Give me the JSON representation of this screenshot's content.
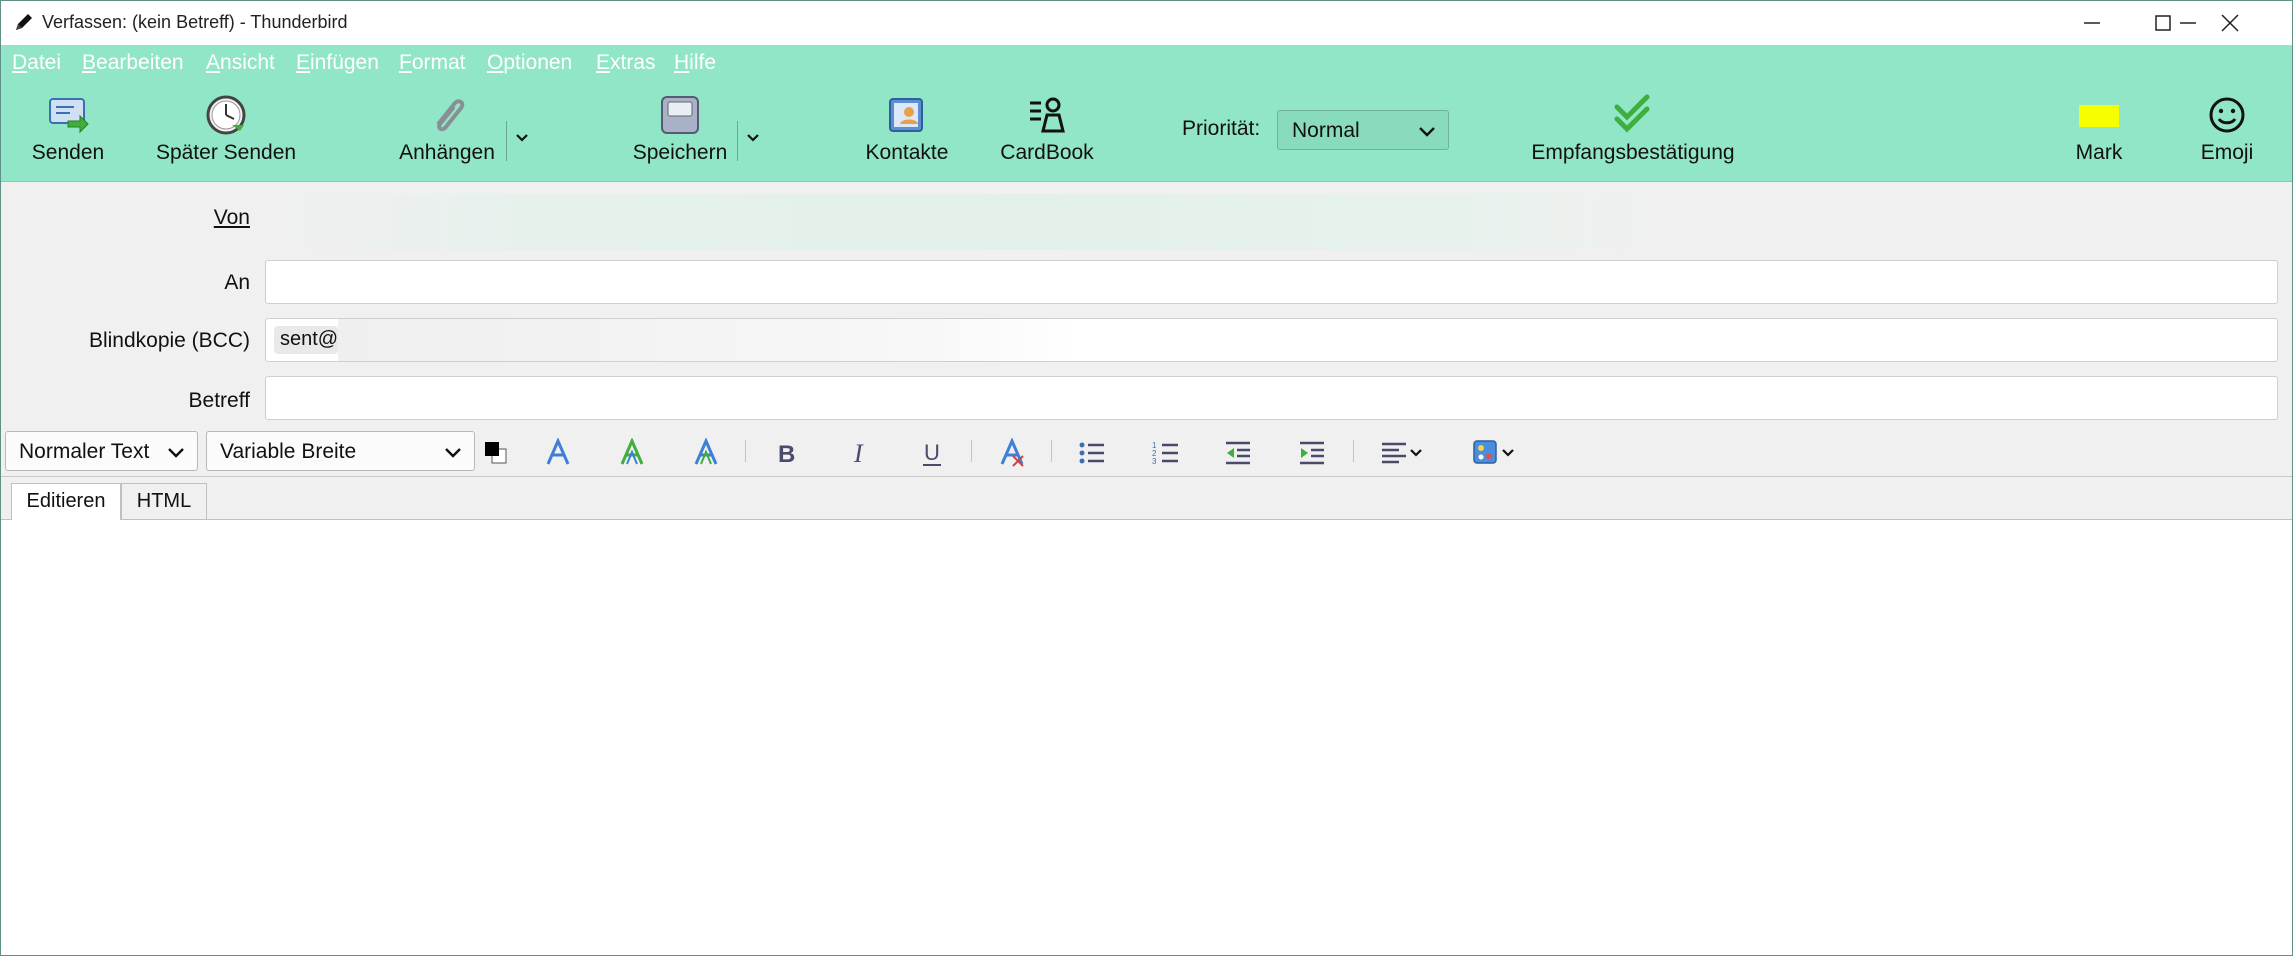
{
  "window": {
    "title": "Verfassen: (kein Betreff) - Thunderbird"
  },
  "menu": {
    "items": [
      {
        "label": "Datei",
        "key": "D",
        "rest": "atei"
      },
      {
        "label": "Bearbeiten",
        "key": "B",
        "rest": "earbeiten"
      },
      {
        "label": "Ansicht",
        "key": "A",
        "rest": "nsicht"
      },
      {
        "label": "Einfügen",
        "key": "E",
        "rest": "infügen"
      },
      {
        "label": "Format",
        "key": "F",
        "rest": "ormat"
      },
      {
        "label": "Optionen",
        "key": "O",
        "rest": "ptionen"
      },
      {
        "label": "Extras",
        "key": "E",
        "rest": "xtras"
      },
      {
        "label": "Hilfe",
        "key": "H",
        "rest": "ilfe"
      }
    ]
  },
  "toolbar": {
    "send": "Senden",
    "send_later": "Später Senden",
    "attach": "Anhängen",
    "save": "Speichern",
    "contacts": "Kontakte",
    "cardbook": "CardBook",
    "priority_label": "Priorität:",
    "priority_value": "Normal",
    "receipt": "Empfangsbestätigung",
    "mark": "Mark",
    "emoji": "Emoji",
    "mark_color": "#f5ff00"
  },
  "fields": {
    "from_label": "Von",
    "to_label": "An",
    "bcc_label": "Blindkopie (BCC)",
    "bcc_pill": "sent@",
    "subject_label": "Betreff"
  },
  "format": {
    "paragraph": "Normaler Text",
    "font": "Variable Breite"
  },
  "tabs": {
    "edit": "Editieren",
    "html": "HTML"
  },
  "colors": {
    "accent": "#90e6c6"
  }
}
